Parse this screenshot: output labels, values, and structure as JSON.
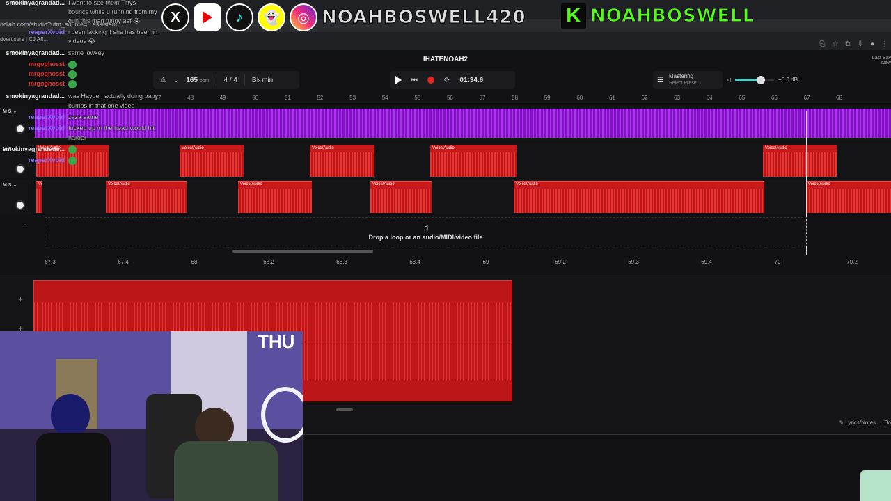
{
  "browser": {
    "address": "ndlab.com/studio?utm_source=...assistant",
    "bookmarks": "dvertisers | CJ Aff..."
  },
  "social": {
    "instagram_handle": "NOAHBOSWELL420",
    "kick_handle": "NOAHBOSWELL",
    "kick_letter": "K"
  },
  "daw": {
    "project_title": "IHATENOAH2",
    "last_saved_line1": "Last Sav",
    "last_saved_line2": "New",
    "bpm": "165",
    "bpm_unit": "bpm",
    "time_signature": "4 / 4",
    "key": "B♭ min",
    "time": "01:34.6",
    "mastering_label": "Mastering",
    "mastering_preset": "Select Preset ›",
    "volume": "+0.0 dB",
    "volume_level": 0.65,
    "ruler_top": [
      "47",
      "48",
      "49",
      "50",
      "51",
      "52",
      "53",
      "54",
      "55",
      "56",
      "57",
      "58",
      "59",
      "60",
      "61",
      "62",
      "63",
      "64",
      "65",
      "66",
      "67",
      "68"
    ],
    "ruler_bottom": [
      "67.3",
      "67.4",
      "68",
      "68.2",
      "68.3",
      "68.4",
      "69",
      "69.2",
      "69.3",
      "69.4",
      "70",
      "70.2"
    ],
    "clip_label": "Voice/Audio",
    "drop_text": "Drop a loop or an audio/MIDI/video file",
    "lyrics_notes": "Lyrics/Notes",
    "bo_label": "Bo",
    "track_ms": "M  S  ⌄"
  },
  "chat": [
    {
      "user": "smokinyagrandad...",
      "text": "I want to see them Tittys",
      "color": "#e8e8e8"
    },
    {
      "user": "",
      "text": "bounce while u running from my",
      "color": "#e8e8e8"
    },
    {
      "user": "",
      "text": "gun this man funny asf 😭",
      "color": "#e8e8e8"
    },
    {
      "user": "reaperXvoid",
      "text": "i been lacking if she has been in",
      "color": "#8a6cff"
    },
    {
      "user": "",
      "text": "videos 😂",
      "color": "#8a6cff"
    },
    {
      "user": "smokinyagrandad...",
      "text": "same lowkey",
      "color": "#e8e8e8"
    },
    {
      "user": "mrgoghosst",
      "text": "",
      "color": "#e0342f"
    },
    {
      "user": "mrgoghosst",
      "text": "",
      "color": "#e0342f"
    },
    {
      "user": "mrgoghosst",
      "text": "",
      "color": "#e0342f"
    },
    {
      "user": "smokinyagrandad...",
      "text": "was Hayden actually doing baby",
      "color": "#e8e8e8"
    },
    {
      "user": "",
      "text": "bumps in that one video",
      "color": "#e8e8e8"
    },
    {
      "user": "reaperXvoid",
      "text": "zaza same",
      "color": "#8a6cff"
    },
    {
      "user": "reaperXvoid",
      "text": "fucked up in the head would hit",
      "color": "#8a6cff"
    },
    {
      "user": "",
      "text": "harder",
      "color": "#8a6cff"
    },
    {
      "user": "smokinyagrandade...",
      "text": "",
      "color": "#e8e8e8"
    },
    {
      "user": "reaperXvoid",
      "text": "",
      "color": "#8a6cff"
    }
  ],
  "colors": {
    "accent_red": "#c8191b",
    "purple_wave": "#b72bff",
    "kick_green": "#53fc18"
  }
}
